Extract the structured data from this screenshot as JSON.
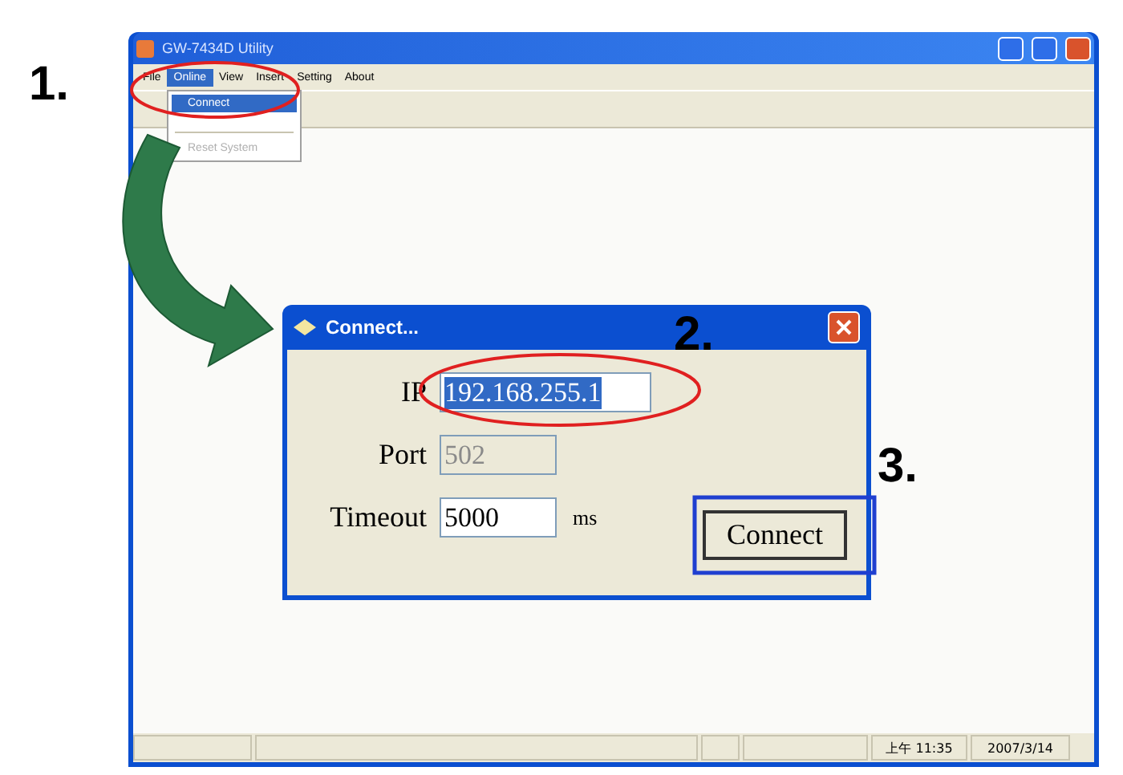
{
  "window": {
    "title": "GW-7434D Utility"
  },
  "menu_bar": [
    {
      "label": "File",
      "selected": false
    },
    {
      "label": "Online",
      "selected": true
    },
    {
      "label": "View",
      "selected": false
    },
    {
      "label": "Insert",
      "selected": false
    },
    {
      "label": "Setting",
      "selected": false
    },
    {
      "label": "About",
      "selected": false
    }
  ],
  "online_menu": [
    {
      "label": "Connect",
      "selected": true,
      "disabled": false
    },
    {
      "label": "Reset System",
      "selected": false,
      "disabled": true
    }
  ],
  "dialog": {
    "title": "Connect...",
    "fields": [
      {
        "label": "IP",
        "value": "192.168.255.1",
        "disabled": false,
        "selected": true
      },
      {
        "label": "Port",
        "value": "502",
        "disabled": true,
        "selected": false
      },
      {
        "label": "Timeout",
        "value": "5000",
        "unit": "ms",
        "disabled": false,
        "selected": false
      }
    ],
    "button": "Connect"
  },
  "status_bar": {
    "time": "上午 11:35",
    "date": "2007/3/14"
  },
  "steps": [
    "1.",
    "2.",
    "3."
  ]
}
